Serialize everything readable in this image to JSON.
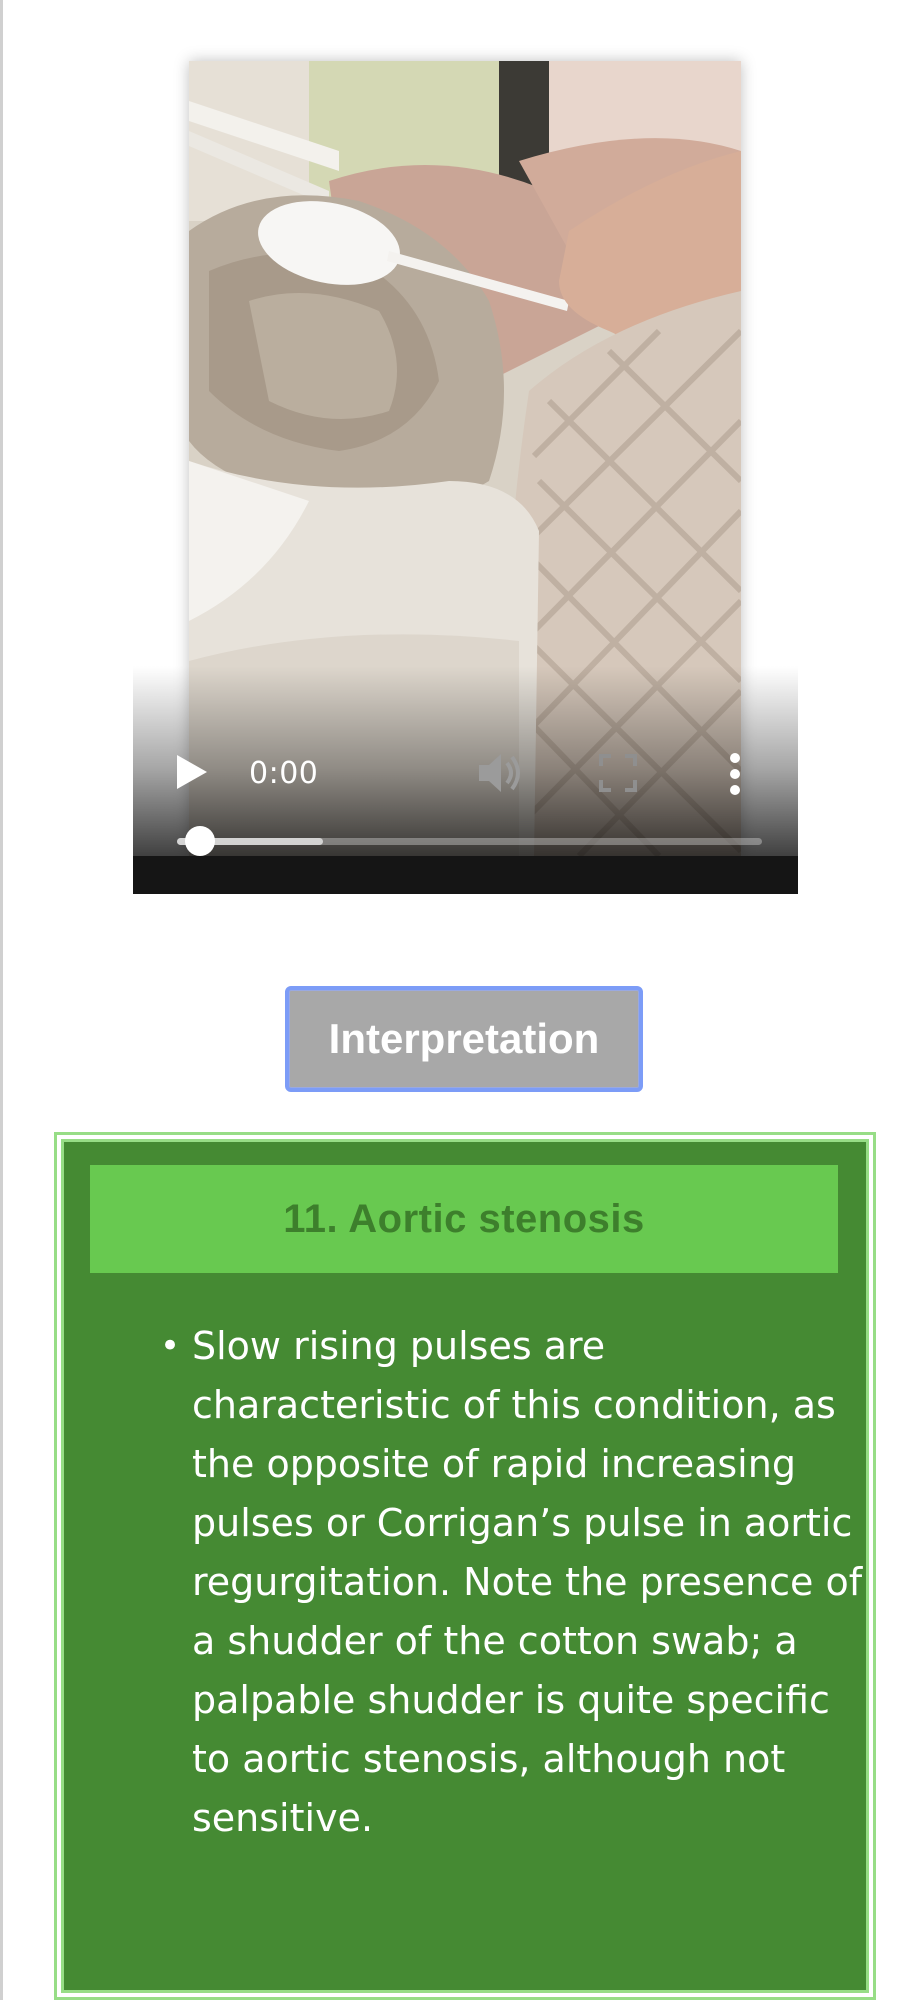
{
  "video": {
    "current_time": "0:00",
    "played_fraction": 0.04,
    "buffered_fraction": 0.25,
    "controls": {
      "play": "play-icon",
      "volume": "volume-muted-icon",
      "fullscreen": "fullscreen-icon",
      "menu": "more-vertical-icon"
    }
  },
  "interpretation_button": {
    "label": "Interpretation"
  },
  "answer_panel": {
    "title": "11. Aortic stenosis",
    "bullet": "Slow rising pulses are characteristic of this condition, as the opposite of rapid increasing pulses or Corrigan’s pulse in aortic regurgitation. Note the presence of a shudder of the cotton swab; a palpable shudder is quite specific to aortic stenosis, although not sensitive."
  },
  "colors": {
    "panel_background": "#458a33",
    "panel_header_background": "#68c950",
    "panel_header_text": "#3d7f2c",
    "panel_border": "#97dd86",
    "button_background": "#a8a8a8",
    "button_border": "#7c9cf7"
  }
}
